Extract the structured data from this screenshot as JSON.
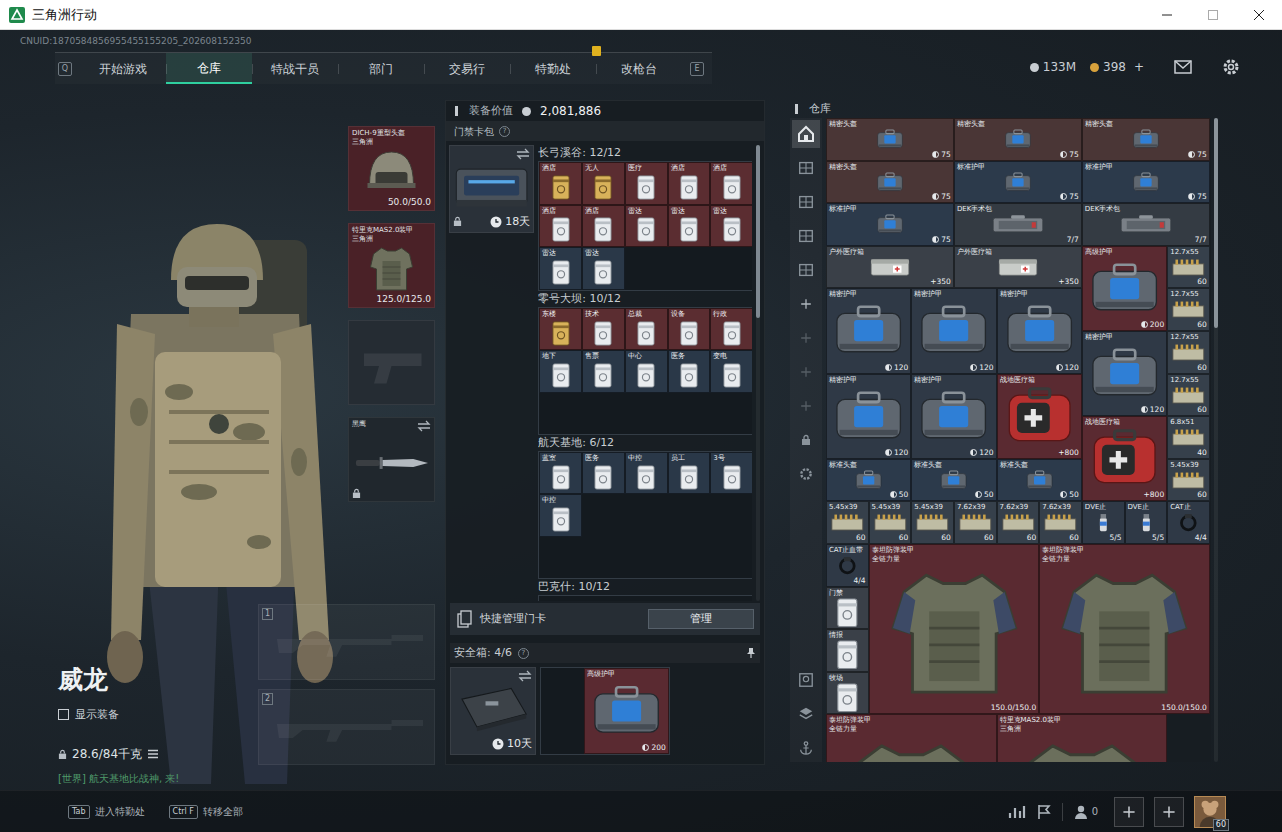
{
  "window": {
    "title": "三角洲行动"
  },
  "uid": "CNUID:1870584856955455155205_202608152350",
  "nav": {
    "prev_key": "Q",
    "next_key": "E",
    "tabs": [
      {
        "label": "开始游戏",
        "selected": false,
        "alert": false
      },
      {
        "label": "仓库",
        "selected": true,
        "alert": false
      },
      {
        "label": "特战干员",
        "selected": false,
        "alert": false
      },
      {
        "label": "部门",
        "selected": false,
        "alert": false
      },
      {
        "label": "交易行",
        "selected": false,
        "alert": false
      },
      {
        "label": "特勤处",
        "selected": false,
        "alert": true
      },
      {
        "label": "改枪台",
        "selected": false,
        "alert": false
      }
    ]
  },
  "currency": [
    {
      "amount": "133M",
      "color": "#c9ced3"
    },
    {
      "amount": "398",
      "add": "+",
      "color": "#d8a23c"
    }
  ],
  "character": {
    "name": "威龙",
    "show_gear": {
      "label": "显示装备",
      "checked": false
    },
    "weight": "28.6/84千克",
    "chat": "[世界] 航天基地比战神, 来!"
  },
  "equipment": [
    {
      "kind": "helmet",
      "name": "DICH-9重型头盔",
      "brand": "三角洲",
      "durability": "50.0/50.0",
      "color": "#4a2127"
    },
    {
      "kind": "vest",
      "name": "特里克MAS2.0装甲",
      "brand": "三角洲",
      "durability": "125.0/125.0",
      "color": "#4a2127"
    },
    {
      "kind": "pistol",
      "color": "#252c33"
    },
    {
      "kind": "knife",
      "name": "黑鹰",
      "locked": true,
      "color": "#20272d"
    }
  ],
  "weapons": [
    {
      "slot": "1"
    },
    {
      "slot": "2"
    }
  ],
  "loadout_value": {
    "label": "装备价值",
    "value": "2,081,886"
  },
  "keycards": {
    "title": "门禁卡包",
    "help": "?",
    "pack_days": "18天",
    "pack_locked": true,
    "maps": [
      {
        "title": "长弓溪谷: 12/12",
        "cards": [
          {
            "label": "酒店",
            "kind": "gold",
            "color": "#5b2d31"
          },
          {
            "label": "无人",
            "kind": "gold",
            "color": "#5b2d31"
          },
          {
            "label": "医疗",
            "kind": "white",
            "color": "#5b2d31"
          },
          {
            "label": "酒店",
            "kind": "white",
            "color": "#5b2d31"
          },
          {
            "label": "酒店",
            "kind": "white",
            "color": "#5b2d31"
          },
          {
            "label": "酒店",
            "kind": "white",
            "color": "#5b2d31"
          },
          {
            "label": "酒店",
            "kind": "white",
            "color": "#5b2d31"
          },
          {
            "label": "雷达",
            "kind": "white",
            "color": "#5b2d31"
          },
          {
            "label": "雷达",
            "kind": "white",
            "color": "#5b2d31"
          },
          {
            "label": "雷达",
            "kind": "white",
            "color": "#5b2d31"
          },
          {
            "label": "雷达",
            "kind": "white",
            "color": "#2a3848"
          },
          {
            "label": "雷达",
            "kind": "white",
            "color": "#2a3848"
          }
        ]
      },
      {
        "title": "零号大坝: 10/12",
        "cards": [
          {
            "label": "东楼",
            "kind": "gold",
            "color": "#5b2d31"
          },
          {
            "label": "技术",
            "kind": "white",
            "color": "#5b2d31"
          },
          {
            "label": "总裁",
            "kind": "white",
            "color": "#5b2d31"
          },
          {
            "label": "设备",
            "kind": "white",
            "color": "#5b2d31"
          },
          {
            "label": "行政",
            "kind": "white",
            "color": "#5b2d31"
          },
          {
            "label": "地下",
            "kind": "white",
            "color": "#2a3848"
          },
          {
            "label": "售票",
            "kind": "white",
            "color": "#2a3848"
          },
          {
            "label": "中心",
            "kind": "white",
            "color": "#2a3848"
          },
          {
            "label": "医务",
            "kind": "white",
            "color": "#2a3848"
          },
          {
            "label": "变电",
            "kind": "white",
            "color": "#2a3848"
          }
        ]
      },
      {
        "title": "航天基地: 6/12",
        "cards": [
          {
            "label": "蓝室",
            "kind": "white",
            "color": "#2a3848"
          },
          {
            "label": "医务",
            "kind": "white",
            "color": "#2a3848"
          },
          {
            "label": "中控",
            "kind": "white",
            "color": "#2a3848"
          },
          {
            "label": "员工",
            "kind": "white",
            "color": "#2a3848"
          },
          {
            "label": "3号",
            "kind": "white",
            "color": "#2a3848"
          },
          {
            "label": "中控",
            "kind": "white",
            "color": "#2a3848"
          }
        ]
      },
      {
        "title": "巴克什: 10/12",
        "cards": []
      }
    ],
    "quick_manage": "快捷管理门卡",
    "manage_button": "管理"
  },
  "safebox": {
    "title": "安全箱: 4/6",
    "help": "?",
    "days": "10天",
    "items": [
      {
        "name": "高级护甲",
        "value": "200",
        "kind": "kit2x2",
        "color": "#5a2a31"
      }
    ]
  },
  "warehouse": {
    "title": "仓库",
    "sidebar_top": [
      {
        "kind": "home",
        "selected": true,
        "disabled": false
      },
      {
        "kind": "shelf",
        "selected": false,
        "disabled": false
      },
      {
        "kind": "shelf",
        "selected": false,
        "disabled": false
      },
      {
        "kind": "shelf",
        "selected": false,
        "disabled": false
      },
      {
        "kind": "shelf",
        "selected": false,
        "disabled": false
      },
      {
        "kind": "add",
        "selected": false,
        "disabled": false
      },
      {
        "kind": "add",
        "selected": false,
        "disabled": true
      },
      {
        "kind": "add",
        "selected": false,
        "disabled": true
      },
      {
        "kind": "add",
        "selected": false,
        "disabled": true
      },
      {
        "kind": "lock",
        "selected": false,
        "disabled": false
      },
      {
        "kind": "gear",
        "selected": false,
        "disabled": false
      }
    ],
    "sidebar_bottom": [
      {
        "kind": "photo",
        "selected": false,
        "disabled": false
      },
      {
        "kind": "layers",
        "selected": false,
        "disabled": false
      },
      {
        "kind": "anchor",
        "selected": false,
        "disabled": false
      }
    ],
    "items": [
      {
        "name": "精密头盔",
        "value": "75",
        "kind": "kit3",
        "color": "#4a3636"
      },
      {
        "name": "精密头盔",
        "value": "75",
        "kind": "kit3",
        "color": "#4a3636"
      },
      {
        "name": "精密头盔",
        "value": "75",
        "kind": "kit3",
        "color": "#4a3636"
      },
      {
        "name": "精密头盔",
        "value": "75",
        "kind": "kit3",
        "color": "#4a3636"
      },
      {
        "name": "标准护甲",
        "value": "75",
        "kind": "kit3",
        "color": "#2c3a4b"
      },
      {
        "name": "标准护甲",
        "value": "75",
        "kind": "kit3",
        "color": "#2c3a4b"
      },
      {
        "name": "标准护甲",
        "value": "75",
        "kind": "kit3",
        "color": "#2c3a4b"
      },
      {
        "name": "DEK手术包",
        "value": "7/7",
        "kind": "case3",
        "color": "#343b43"
      },
      {
        "name": "DEK手术包",
        "value": "7/7",
        "kind": "case3",
        "color": "#343b43"
      },
      {
        "name": "户外医疗箱",
        "value": "+350",
        "kind": "med3",
        "color": "#3a4048"
      },
      {
        "name": "户外医疗箱",
        "value": "+350",
        "kind": "med3",
        "color": "#3a4048"
      },
      {
        "name": "高级护甲",
        "value": "200",
        "kind": "kit2x2",
        "color": "#5a2a31"
      },
      {
        "name": "12.7x55",
        "value": "60",
        "kind": "ammo",
        "color": "#36404b"
      },
      {
        "name": "精密护甲",
        "value": "120",
        "kind": "kit2x2",
        "color": "#2f3946"
      },
      {
        "name": "精密护甲",
        "value": "120",
        "kind": "kit2x2",
        "color": "#2f3946"
      },
      {
        "name": "精密护甲",
        "value": "120",
        "kind": "kit2x2",
        "color": "#2f3946"
      },
      {
        "name": "12.7x55",
        "value": "60",
        "kind": "ammo",
        "color": "#36404b"
      },
      {
        "name": "精密护甲",
        "value": "120",
        "kind": "kit2x2",
        "color": "#2f3946"
      },
      {
        "name": "12.7x55",
        "value": "60",
        "kind": "ammo",
        "color": "#36404b"
      },
      {
        "name": "精密护甲",
        "value": "120",
        "kind": "kit2x2",
        "color": "#2f3946"
      },
      {
        "name": "精密护甲",
        "value": "120",
        "kind": "kit2x2",
        "color": "#2f3946"
      },
      {
        "name": "战地医疗箱",
        "value": "+800",
        "kind": "medcase",
        "color": "#5a2a31"
      },
      {
        "name": "12.7x55",
        "value": "60",
        "kind": "ammo",
        "color": "#36404b"
      },
      {
        "name": "战地医疗箱",
        "value": "+800",
        "kind": "medcase",
        "color": "#5a2a31"
      },
      {
        "name": "6.8x51",
        "value": "40",
        "kind": "ammo",
        "color": "#36404b"
      },
      {
        "name": "标准头盔",
        "value": "50",
        "kind": "kit2",
        "color": "#2c3a4b"
      },
      {
        "name": "标准头盔",
        "value": "50",
        "kind": "kit2",
        "color": "#2c3a4b"
      },
      {
        "name": "标准头盔",
        "value": "50",
        "kind": "kit2",
        "color": "#2c3a4b"
      },
      {
        "name": "5.45x39",
        "value": "60",
        "kind": "ammo",
        "color": "#36404b"
      },
      {
        "name": "5.45x39",
        "value": "60",
        "kind": "ammo",
        "color": "#36404b"
      },
      {
        "name": "5.45x39",
        "value": "60",
        "kind": "ammo",
        "color": "#36404b"
      },
      {
        "name": "5.45x39",
        "value": "60",
        "kind": "ammo",
        "color": "#36404b"
      },
      {
        "name": "7.62x39",
        "value": "60",
        "kind": "ammo",
        "color": "#36404b"
      },
      {
        "name": "7.62x39",
        "value": "60",
        "kind": "ammo",
        "color": "#36404b"
      },
      {
        "name": "7.62x39",
        "value": "60",
        "kind": "ammo",
        "color": "#36404b"
      },
      {
        "name": "DVE止",
        "value": "5/5",
        "kind": "drug",
        "color": "#2f3946"
      },
      {
        "name": "DVE止",
        "value": "5/5",
        "kind": "drug",
        "color": "#2f3946"
      },
      {
        "name": "CAT止",
        "value": "4/4",
        "kind": "tourniquet",
        "color": "#2f3946"
      },
      {
        "name": "CAT止血带",
        "value": "4/4",
        "kind": "tourniquet",
        "color": "#2f3946"
      },
      {
        "name": "泰坦防弹装甲",
        "brand": "全链力量",
        "value": "150.0/150.0",
        "kind": "armor",
        "color": "#5a2a31"
      },
      {
        "name": "泰坦防弹装甲",
        "brand": "全链力量",
        "value": "150.0/150.0",
        "kind": "armor",
        "color": "#5a2a31"
      },
      {
        "name": "门禁",
        "kind": "card",
        "color": "#3a4048"
      },
      {
        "name": "情报",
        "kind": "card",
        "color": "#3a4048"
      },
      {
        "name": "牧场",
        "kind": "card",
        "color": "#3a4048"
      },
      {
        "name": "泰坦防弹装甲",
        "brand": "全链力量",
        "kind": "armor",
        "color": "#5a2a31"
      },
      {
        "name": "特里克MAS2.0装甲",
        "brand": "三角洲",
        "kind": "armor",
        "color": "#5a2a31"
      }
    ]
  },
  "bottom_bar": {
    "hints": [
      {
        "key": "Tab",
        "label": "进入特勤处"
      },
      {
        "key": "Ctrl F",
        "label": "转移全部"
      }
    ],
    "friends": "0",
    "level": "60"
  }
}
